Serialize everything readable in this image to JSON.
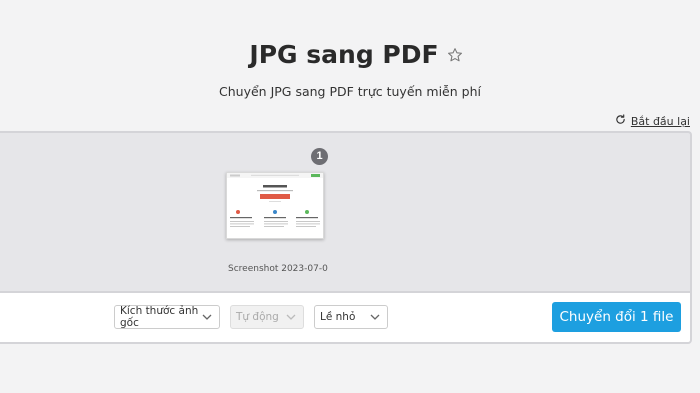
{
  "header": {
    "title": "JPG sang PDF",
    "subtitle": "Chuyển JPG sang PDF trực tuyến miễn phí"
  },
  "toolbar_top": {
    "restart_label": "Bắt đầu lại"
  },
  "files": [
    {
      "index": "1",
      "name": "Screenshot 2023-07-0..."
    }
  ],
  "options": {
    "page_size": "Kích thước ảnh gốc",
    "orientation": "Tự động",
    "margin": "Lề nhỏ"
  },
  "convert_label": "Chuyển đổi 1 file",
  "colors": {
    "accent": "#1d9fe0",
    "badge": "#6e6e73",
    "dropzone": "#e6e6e9"
  }
}
